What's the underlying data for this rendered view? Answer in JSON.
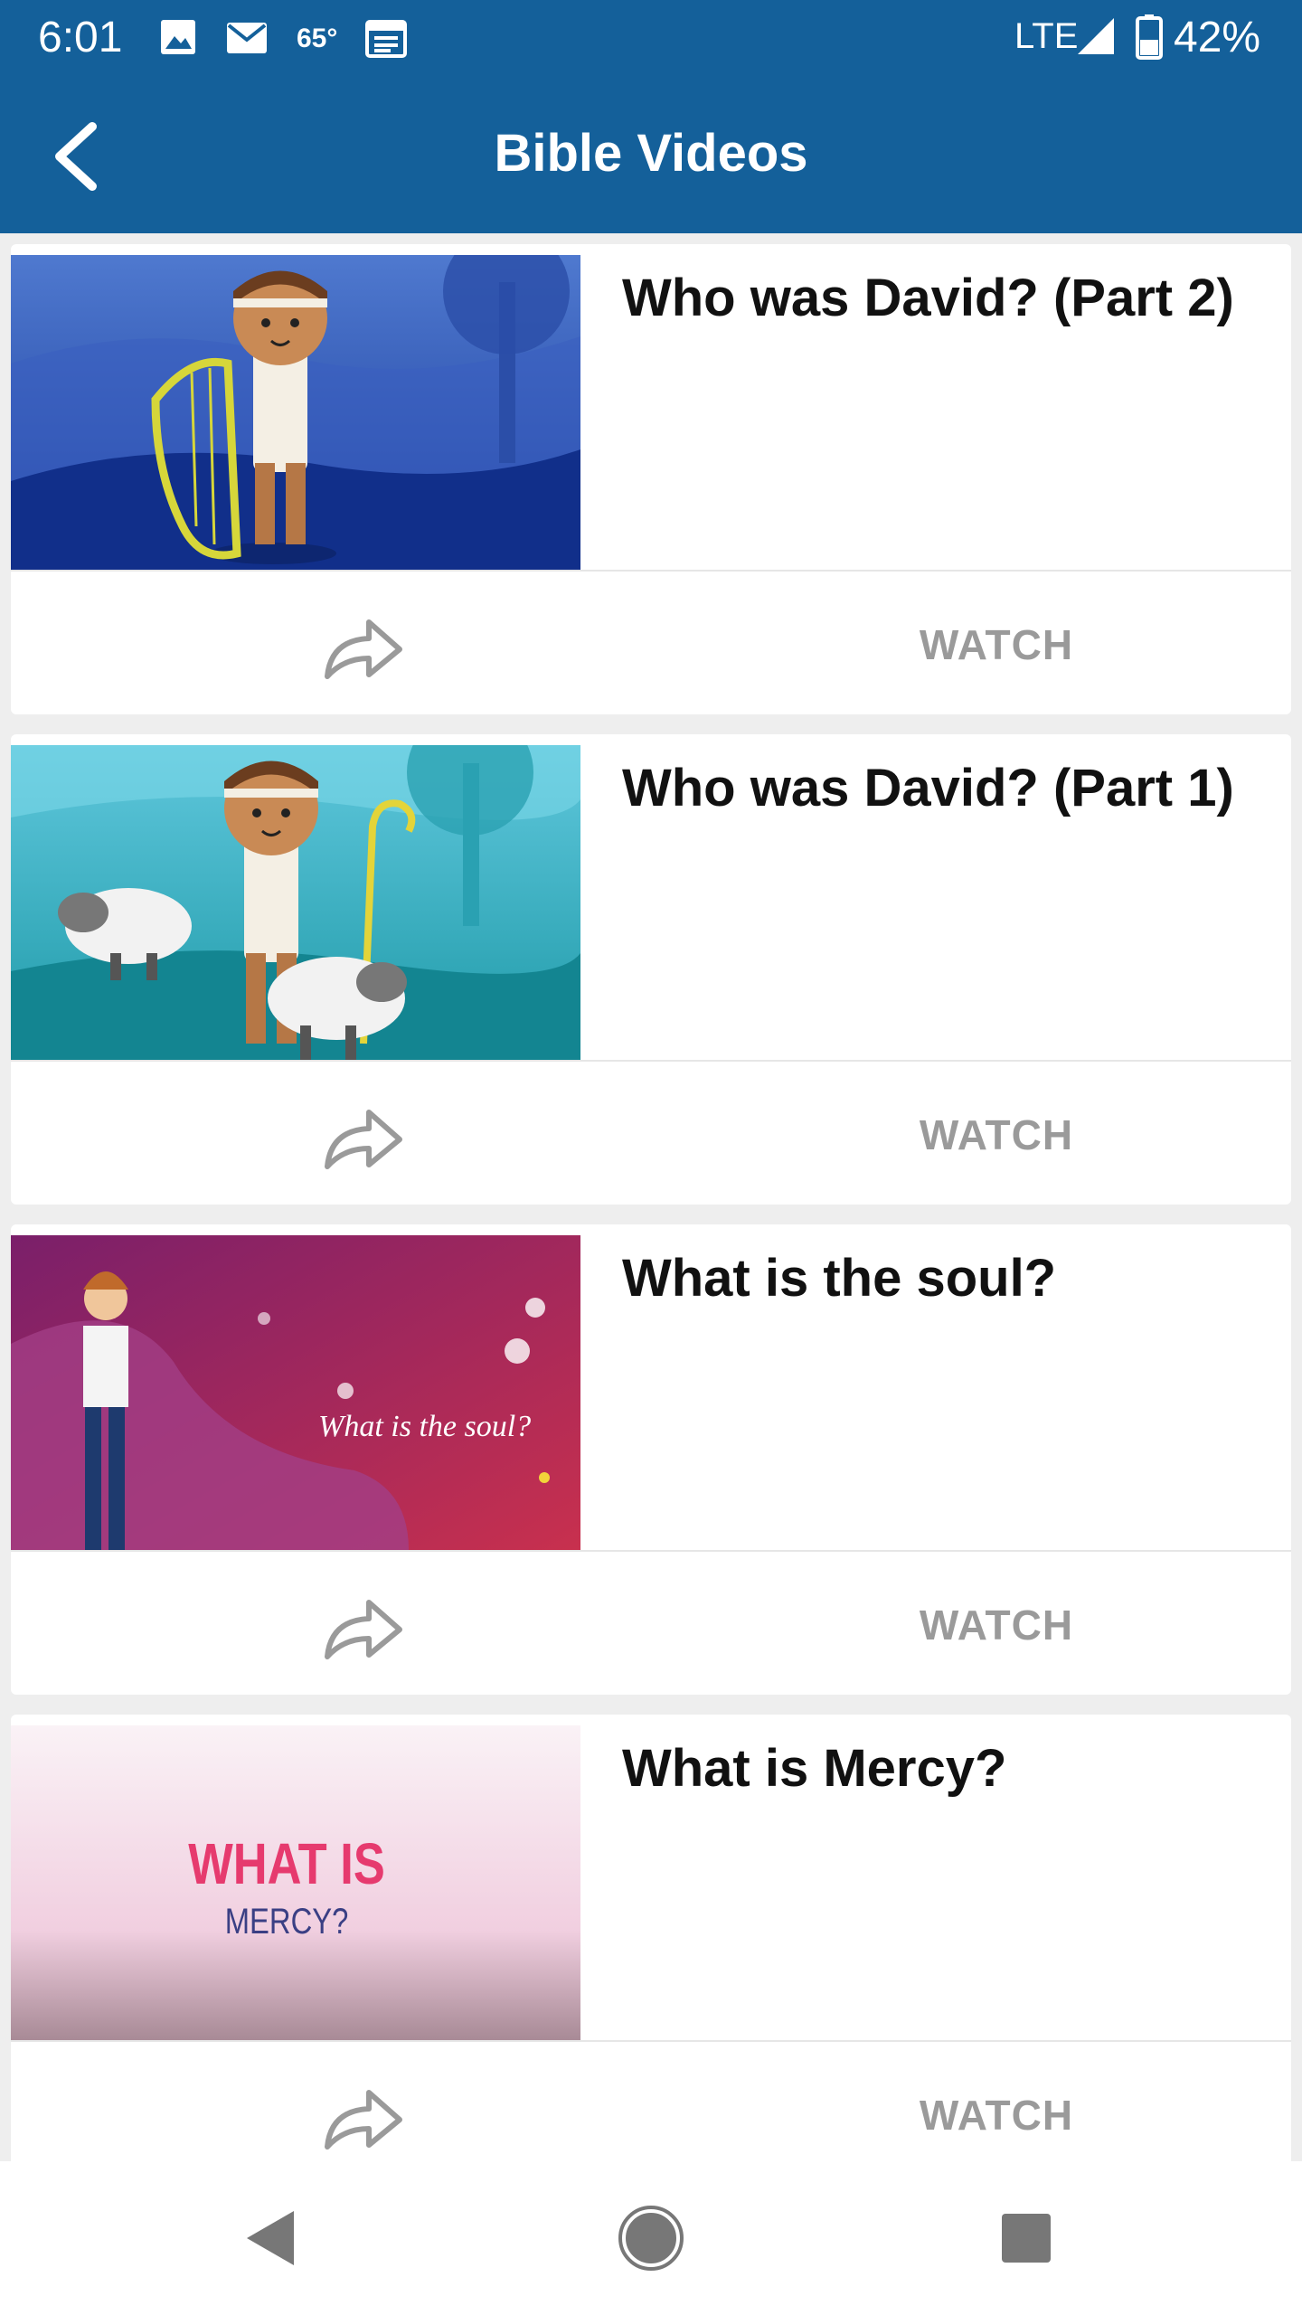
{
  "status_bar": {
    "time": "6:01",
    "temperature": "65°",
    "network": "LTE",
    "battery": "42%",
    "icons": [
      "image-icon",
      "mail-icon",
      "calendar-icon",
      "signal-icon",
      "battery-icon"
    ]
  },
  "app_bar": {
    "title": "Bible Videos",
    "back_icon": "chevron-left-icon",
    "color": "#14609a"
  },
  "videos": [
    {
      "title": "Who was David? (Part 2)",
      "watch_label": "WATCH",
      "share_icon": "share-arrow-icon"
    },
    {
      "title": "Who was David? (Part 1)",
      "watch_label": "WATCH",
      "share_icon": "share-arrow-icon"
    },
    {
      "title": "What is the soul?",
      "watch_label": "WATCH",
      "share_icon": "share-arrow-icon",
      "thumbnail_text": "What is the soul?"
    },
    {
      "title": "What is Mercy?",
      "watch_label": "WATCH",
      "share_icon": "share-arrow-icon",
      "thumbnail_text_line1": "WHAT IS",
      "thumbnail_text_line2": "MERCY?"
    }
  ],
  "nav_bar": {
    "icons": [
      "back-triangle-icon",
      "home-circle-icon",
      "recents-square-icon"
    ]
  }
}
